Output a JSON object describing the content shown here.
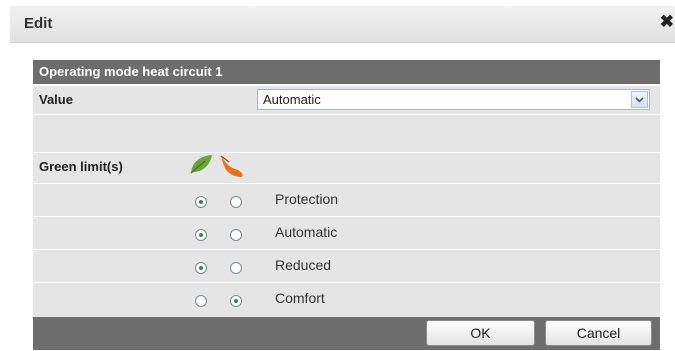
{
  "dialog": {
    "title": "Edit",
    "close_symbol": "✖"
  },
  "panel": {
    "header": "Operating mode heat circuit 1",
    "value_label": "Value",
    "select": {
      "selected": "Automatic"
    },
    "green_label": "Green limit(s)",
    "icons": [
      "green-leaf-icon",
      "orange-leaf-icon"
    ],
    "colors": {
      "green_leaf": "#6aa43a",
      "orange_leaf": "#e8731c",
      "header_bg": "#6d6d6d",
      "row_bg": "#e5e5e5"
    },
    "modes": [
      {
        "label": "Protection",
        "green_selected": true
      },
      {
        "label": "Automatic",
        "green_selected": true
      },
      {
        "label": "Reduced",
        "green_selected": true
      },
      {
        "label": "Comfort",
        "green_selected": false
      }
    ]
  },
  "footer": {
    "ok_label": "OK",
    "cancel_label": "Cancel"
  }
}
